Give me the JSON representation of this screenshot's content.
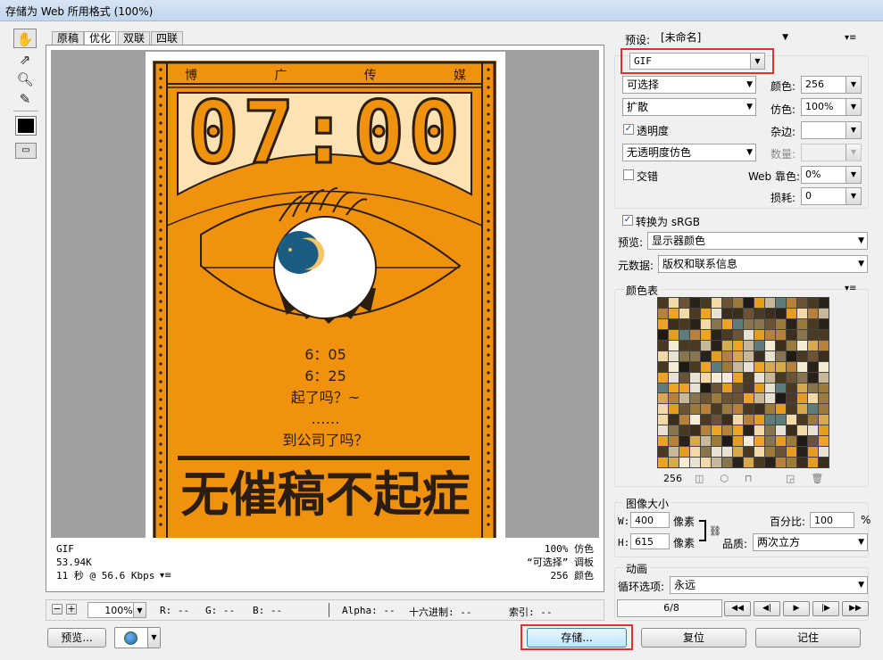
{
  "window": {
    "title": "存储为 Web 所用格式 (100%)"
  },
  "tabs": [
    "原稿",
    "优化",
    "双联",
    "四联"
  ],
  "active_tab": 1,
  "tools": {
    "hand": "hand-icon",
    "slice_select": "slice-select-icon",
    "zoom": "zoom-icon",
    "eyedropper": "eyedropper-icon",
    "color": "#000000"
  },
  "poster": {
    "header_chars": [
      "博",
      "广",
      "传",
      "媒"
    ],
    "time": "07:00",
    "lines": [
      "6：05",
      "6：25",
      "起了吗？~",
      "……",
      "到公司了吗？"
    ],
    "big_text": "无催稿不起症",
    "colors": {
      "orange": "#f0920e",
      "dark": "#2b1d12",
      "cream": "#fde3b3",
      "eye_blue": "#1a5c82"
    }
  },
  "preview_info": {
    "format": "GIF",
    "size": "53.94K",
    "time": "11 秒 @ 56.6 Kbps",
    "dither": "100% 仿色",
    "palette": "“可选择” 调板",
    "colors": "256 颜色"
  },
  "status_bar": {
    "zoom": "100%",
    "r": "R: --",
    "g": "G: --",
    "b": "B: --",
    "alpha": "Alpha: --",
    "hex": "十六进制: --",
    "index": "索引: --"
  },
  "bottom": {
    "preview_btn": "预览...",
    "save_btn": "存储...",
    "reset_btn": "复位",
    "remember_btn": "记住"
  },
  "settings": {
    "preset_label": "预设:",
    "preset_value": "[未命名]",
    "format": "GIF",
    "reduction": "可选择",
    "dither_algo": "扩散",
    "transparency_label": "透明度",
    "transparency_checked": true,
    "matte_dither": "无透明度仿色",
    "interlace_label": "交错",
    "interlace_checked": false,
    "colors_label": "颜色:",
    "colors_value": "256",
    "dither_label": "仿色:",
    "dither_value": "100%",
    "matte_label": "杂边:",
    "matte_value": "",
    "amount_label": "数量:",
    "amount_value": "",
    "websnap_label": "Web 靠色:",
    "websnap_value": "0%",
    "lossy_label": "损耗:",
    "lossy_value": "0",
    "convert_srgb_label": "转换为 sRGB",
    "convert_srgb_checked": true,
    "preview_label": "预览:",
    "preview_value": "显示器颜色",
    "metadata_label": "元数据:",
    "metadata_value": "版权和联系信息"
  },
  "color_table": {
    "title": "颜色表",
    "count": "256",
    "swatches": [
      "#e8e2d3",
      "#6b5436",
      "#f0a224",
      "#2a2118",
      "#c7b89a",
      "#87764c",
      "#e69c1c",
      "#4a3a22",
      "#f2d9a6",
      "#1f1a14",
      "#b7813a",
      "#d9a74c",
      "#5f7c7a",
      "#f6ebd3",
      "#9c7a3a",
      "#3b2e1d"
    ]
  },
  "image_size": {
    "title": "图像大小",
    "w_label": "W:",
    "w_value": "400",
    "h_label": "H:",
    "h_value": "615",
    "unit": "像素",
    "percent_label": "百分比:",
    "percent_value": "100",
    "percent_unit": "%",
    "quality_label": "品质:",
    "quality_value": "两次立方"
  },
  "animation": {
    "title": "动画",
    "loop_label": "循环选项:",
    "loop_value": "永远",
    "frame": "6/8"
  }
}
